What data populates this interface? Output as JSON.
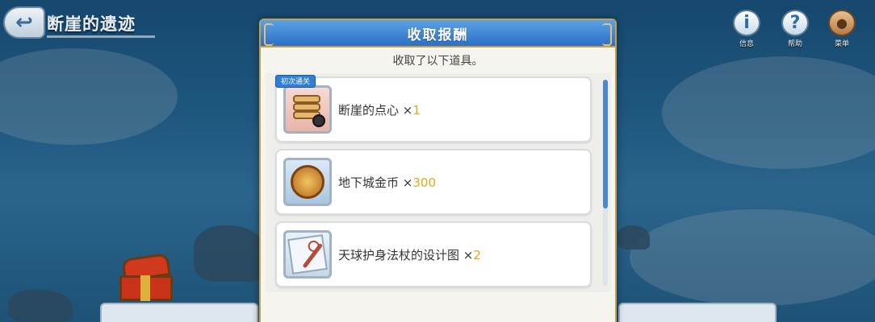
{
  "header": {
    "stage_title": "断崖的遗迹"
  },
  "top_right": {
    "info_label": "信息",
    "help_label": "帮助",
    "menu_label": "菜单"
  },
  "modal": {
    "title": "收取报酬",
    "subtitle": "收取了以下道具。"
  },
  "items": [
    {
      "name": "断崖的点心",
      "mult": "×",
      "qty": "1",
      "badge": "初次通关",
      "icon": "dessert-icon"
    },
    {
      "name": "地下城金币",
      "mult": "×",
      "qty": "300",
      "badge": "",
      "icon": "coin-icon"
    },
    {
      "name": "天球护身法杖的设计图",
      "mult": "×",
      "qty": "2",
      "badge": "",
      "icon": "scroll-icon"
    }
  ],
  "colors": {
    "header_blue": "#2c6fc4",
    "qty_orange": "#e8a51a",
    "frame_gold": "#c7a04f"
  }
}
